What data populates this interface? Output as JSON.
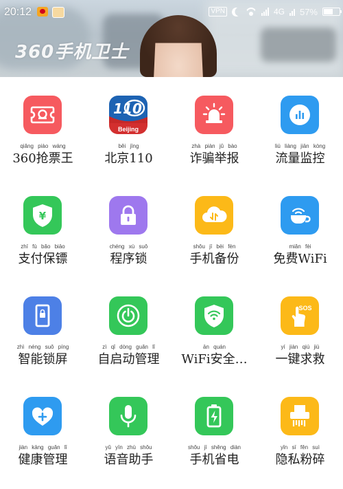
{
  "status_bar": {
    "time": "20:12",
    "vpn": "VPN",
    "network": "4G",
    "battery_percent": "57%",
    "battery_level": 0.57
  },
  "banner": {
    "title": "360手机卫士"
  },
  "colors": {
    "red": "#f65a5f",
    "blue": "#2e9bf0",
    "green": "#34c759",
    "purple": "#9e78ee",
    "yellow": "#fcb918",
    "royal_blue": "#4d80e6"
  },
  "apps": [
    {
      "label": "360抢票王",
      "pinyin": "qiǎng piào wáng",
      "icon": "ticket-icon",
      "color": "#f65a5f"
    },
    {
      "label": "北京110",
      "pinyin": "běi jīng",
      "icon": "beijing-110-icon",
      "color": "#1d63b3",
      "logo_text": "110",
      "logo_sub": "Beijing"
    },
    {
      "label": "诈骗举报",
      "pinyin": "zhà piàn jǔ bào",
      "icon": "alarm-siren-icon",
      "color": "#f65a5f"
    },
    {
      "label": "流量监控",
      "pinyin": "liú liàng jiān kòng",
      "icon": "data-monitor-icon",
      "color": "#2e9bf0"
    },
    {
      "label": "支付保镖",
      "pinyin": "zhī fù bǎo biāo",
      "icon": "payment-shield-icon",
      "color": "#34c759",
      "icon_text": "¥"
    },
    {
      "label": "程序锁",
      "pinyin": "chéng xù suǒ",
      "icon": "app-lock-icon",
      "color": "#9e78ee"
    },
    {
      "label": "手机备份",
      "pinyin": "shǒu jī bèi fèn",
      "icon": "cloud-backup-icon",
      "color": "#fcb918"
    },
    {
      "label": "免费WiFi",
      "pinyin": "miǎn fèi",
      "icon": "wifi-cup-icon",
      "color": "#2e9bf0"
    },
    {
      "label": "智能锁屏",
      "pinyin": "zhì néng suǒ píng",
      "icon": "lock-screen-icon",
      "color": "#4d80e6"
    },
    {
      "label": "自启动管理",
      "pinyin": "zì qǐ dòng guǎn lǐ",
      "icon": "power-icon",
      "color": "#34c759"
    },
    {
      "label": "WiFi安全…",
      "pinyin": "ān quán",
      "icon": "wifi-shield-icon",
      "color": "#34c759"
    },
    {
      "label": "一键求救",
      "pinyin": "yí jiàn qiú jiù",
      "icon": "sos-hand-icon",
      "color": "#fcb918",
      "icon_text": "SOS"
    },
    {
      "label": "健康管理",
      "pinyin": "jiàn kāng guǎn lǐ",
      "icon": "health-heart-icon",
      "color": "#2e9bf0"
    },
    {
      "label": "语音助手",
      "pinyin": "yǔ yīn zhù shǒu",
      "icon": "microphone-icon",
      "color": "#34c759"
    },
    {
      "label": "手机省电",
      "pinyin": "shǒu jī shěng diàn",
      "icon": "battery-saver-icon",
      "color": "#34c759"
    },
    {
      "label": "隐私粉碎",
      "pinyin": "yǐn sī fěn suì",
      "icon": "shredder-icon",
      "color": "#fcb918"
    }
  ]
}
